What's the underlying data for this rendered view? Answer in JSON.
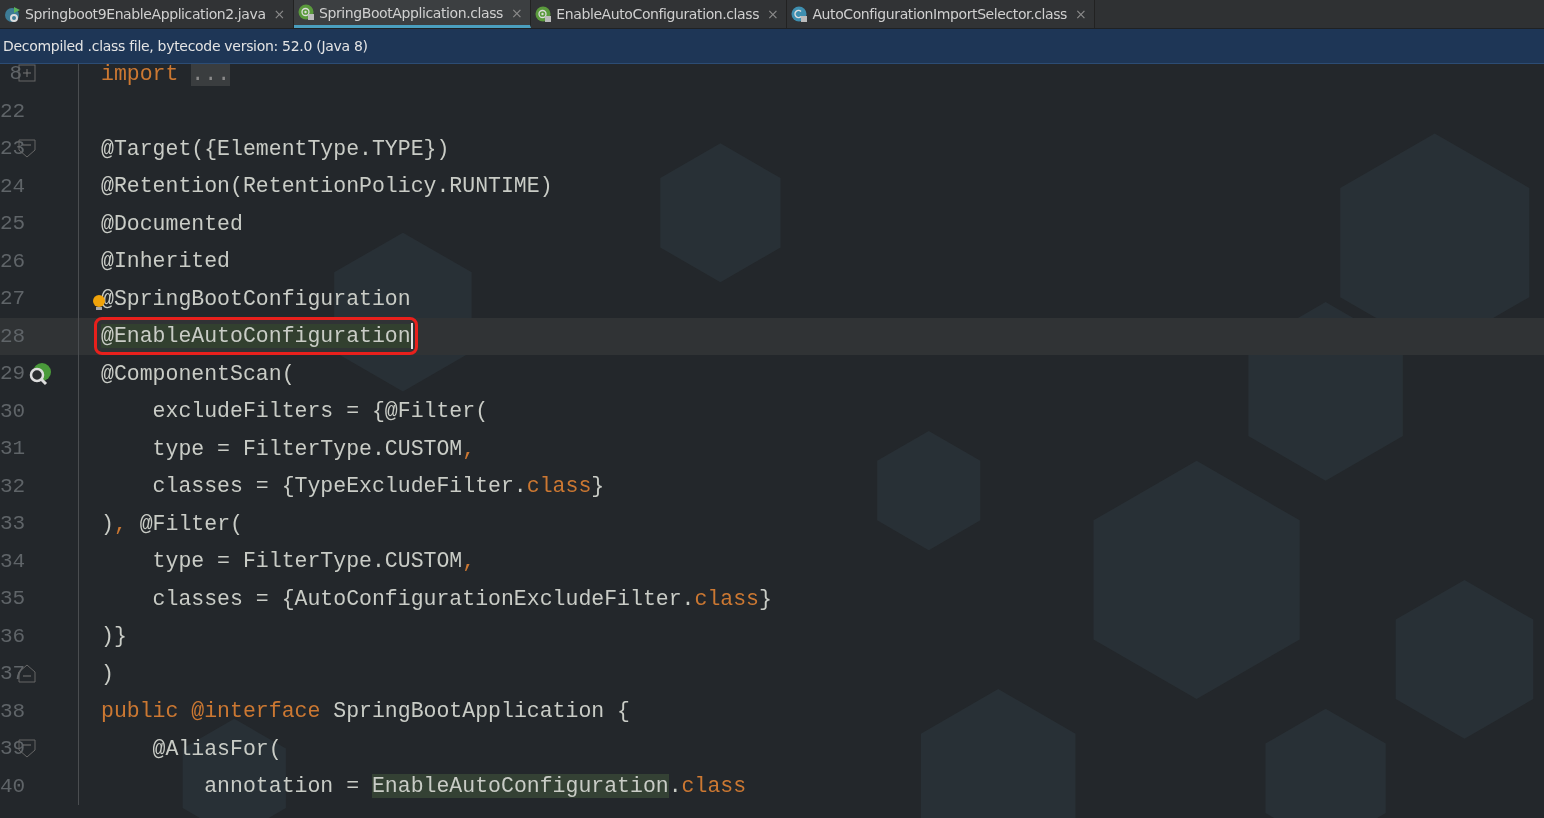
{
  "tabs": [
    {
      "label": "Springboot9EnableApplication2.java",
      "kind": "spring",
      "selected": false,
      "close": "×"
    },
    {
      "label": "SpringBootApplication.class",
      "kind": "annotation",
      "selected": true,
      "close": "×"
    },
    {
      "label": "EnableAutoConfiguration.class",
      "kind": "annotation",
      "selected": false,
      "close": "×"
    },
    {
      "label": "AutoConfigurationImportSelector.class",
      "kind": "class",
      "selected": false,
      "close": "×"
    }
  ],
  "banner": "Decompiled .class file, bytecode version: 52.0 (Java 8)",
  "editor": {
    "lines": [
      {
        "number": "8",
        "current": false,
        "marks": [
          {
            "kind": "fold-expand"
          }
        ],
        "tokens": [
          {
            "text": "import ",
            "kind": "keyword"
          },
          {
            "text": "...",
            "kind": "folded"
          }
        ]
      },
      {
        "number": "22",
        "current": false
      },
      {
        "number": "23",
        "current": false,
        "marks": [
          {
            "kind": "fold-start"
          }
        ],
        "tokens": [
          {
            "text": "@Target({ElementType.TYPE})",
            "kind": "plain"
          }
        ]
      },
      {
        "number": "24",
        "current": false,
        "tokens": [
          {
            "text": "@Retention(RetentionPolicy.RUNTIME)",
            "kind": "plain"
          }
        ]
      },
      {
        "number": "25",
        "current": false,
        "tokens": [
          {
            "text": "@Documented",
            "kind": "plain"
          }
        ]
      },
      {
        "number": "26",
        "current": false,
        "tokens": [
          {
            "text": "@Inherited",
            "kind": "plain"
          }
        ]
      },
      {
        "number": "27",
        "current": false,
        "marks": [
          {
            "kind": "bulb"
          }
        ],
        "tokens": [
          {
            "text": "@SpringBootConfiguration",
            "kind": "plain"
          }
        ]
      },
      {
        "number": "28",
        "current": true,
        "tokens": [
          {
            "text": "@EnableAutoConfiguration",
            "kind": "boxed"
          }
        ]
      },
      {
        "number": "29",
        "current": false,
        "marks": [
          {
            "kind": "bean"
          }
        ],
        "tokens": [
          {
            "text": "@ComponentScan(",
            "kind": "plain"
          }
        ]
      },
      {
        "number": "30",
        "current": false,
        "tokens": [
          {
            "text": "    excludeFilters = {@Filter(",
            "kind": "plain"
          }
        ]
      },
      {
        "number": "31",
        "current": false,
        "tokens": [
          {
            "text": "    type = FilterType.CUSTOM",
            "kind": "plain"
          },
          {
            "text": ",",
            "kind": "keyword"
          }
        ]
      },
      {
        "number": "32",
        "current": false,
        "tokens": [
          {
            "text": "    classes = {TypeExcludeFilter.",
            "kind": "plain"
          },
          {
            "text": "class",
            "kind": "keyword"
          },
          {
            "text": "}",
            "kind": "plain"
          }
        ]
      },
      {
        "number": "33",
        "current": false,
        "tokens": [
          {
            "text": ")",
            "kind": "plain"
          },
          {
            "text": ",",
            "kind": "keyword"
          },
          {
            "text": " @Filter(",
            "kind": "plain"
          }
        ]
      },
      {
        "number": "34",
        "current": false,
        "tokens": [
          {
            "text": "    type = FilterType.CUSTOM",
            "kind": "plain"
          },
          {
            "text": ",",
            "kind": "keyword"
          }
        ]
      },
      {
        "number": "35",
        "current": false,
        "tokens": [
          {
            "text": "    classes = {AutoConfigurationExcludeFilter.",
            "kind": "plain"
          },
          {
            "text": "class",
            "kind": "keyword"
          },
          {
            "text": "}",
            "kind": "plain"
          }
        ]
      },
      {
        "number": "36",
        "current": false,
        "tokens": [
          {
            "text": ")}",
            "kind": "plain"
          }
        ]
      },
      {
        "number": "37",
        "current": false,
        "marks": [
          {
            "kind": "fold-end"
          }
        ],
        "tokens": [
          {
            "text": ")",
            "kind": "plain"
          }
        ]
      },
      {
        "number": "38",
        "current": false,
        "tokens": [
          {
            "text": "public @interface",
            "kind": "keyword"
          },
          {
            "text": " SpringBootApplication {",
            "kind": "plain"
          }
        ]
      },
      {
        "number": "39",
        "current": false,
        "marks": [
          {
            "kind": "fold-start"
          }
        ],
        "tokens": [
          {
            "text": "    @AliasFor(",
            "kind": "plain"
          }
        ]
      },
      {
        "number": "40",
        "current": false,
        "tokens": [
          {
            "text": "        annotation = ",
            "kind": "plain"
          },
          {
            "text": "EnableAutoConfiguration",
            "kind": "usage"
          },
          {
            "text": ".",
            "kind": "plain"
          },
          {
            "text": "class",
            "kind": "keyword"
          }
        ]
      }
    ]
  }
}
